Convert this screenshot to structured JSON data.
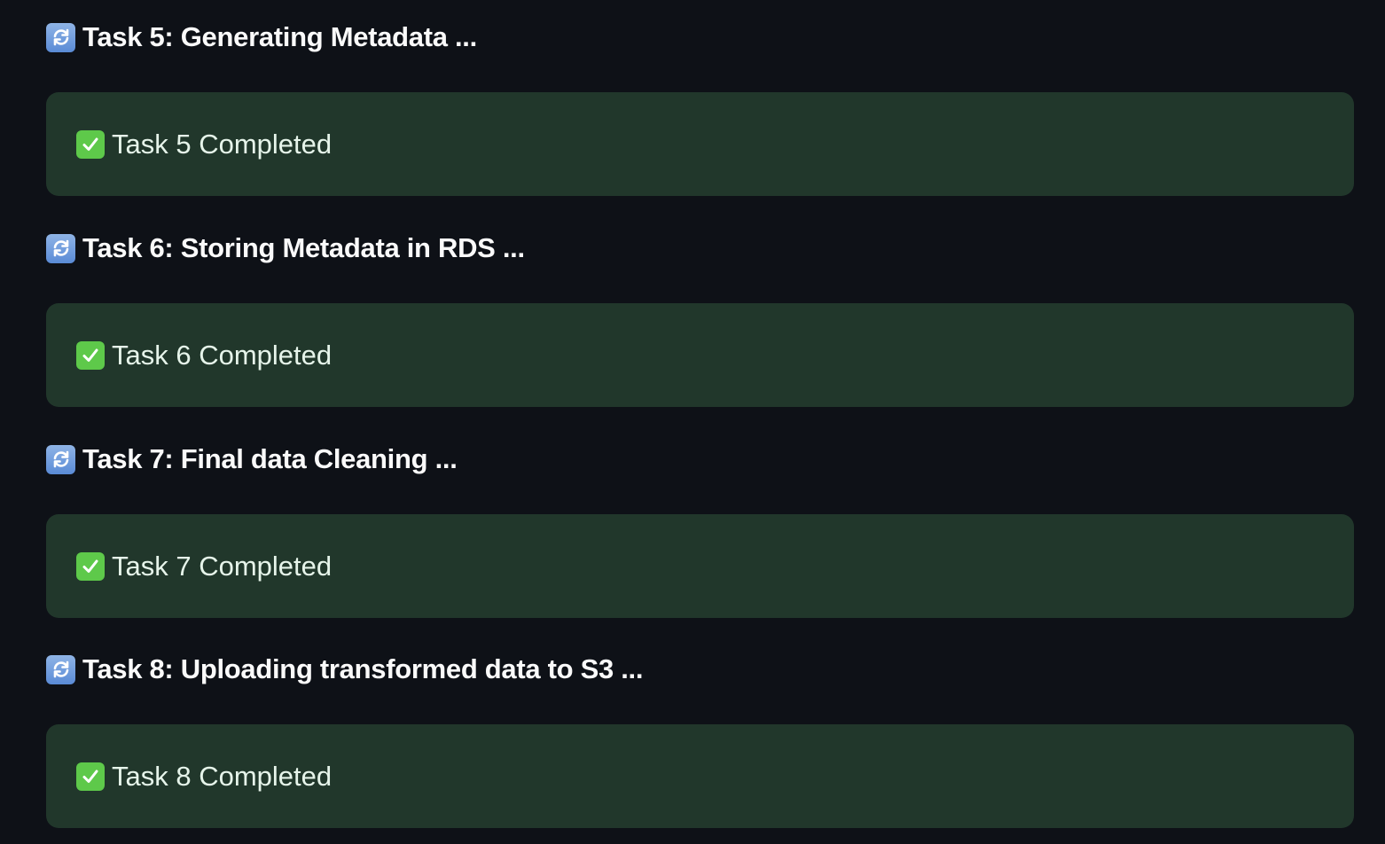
{
  "tasks": [
    {
      "heading_icon": "refresh-icon",
      "title": "Task 5: Generating Metadata ...",
      "status_icon": "check-icon",
      "status": "Task 5 Completed"
    },
    {
      "heading_icon": "refresh-icon",
      "title": "Task 6: Storing Metadata in RDS ...",
      "status_icon": "check-icon",
      "status": "Task 6 Completed"
    },
    {
      "heading_icon": "refresh-icon",
      "title": "Task 7: Final data Cleaning ...",
      "status_icon": "check-icon",
      "status": "Task 7 Completed"
    },
    {
      "heading_icon": "refresh-icon",
      "title": "Task 8: Uploading transformed data to S3 ...",
      "status_icon": "check-icon",
      "status": "Task 8 Completed"
    }
  ],
  "colors": {
    "background": "#0e1117",
    "success_background": "#21372b",
    "success_text": "#e6f4ea",
    "heading_text": "#fafafa",
    "check_green": "#5ec94a",
    "refresh_blue": "#6f9ce0"
  }
}
